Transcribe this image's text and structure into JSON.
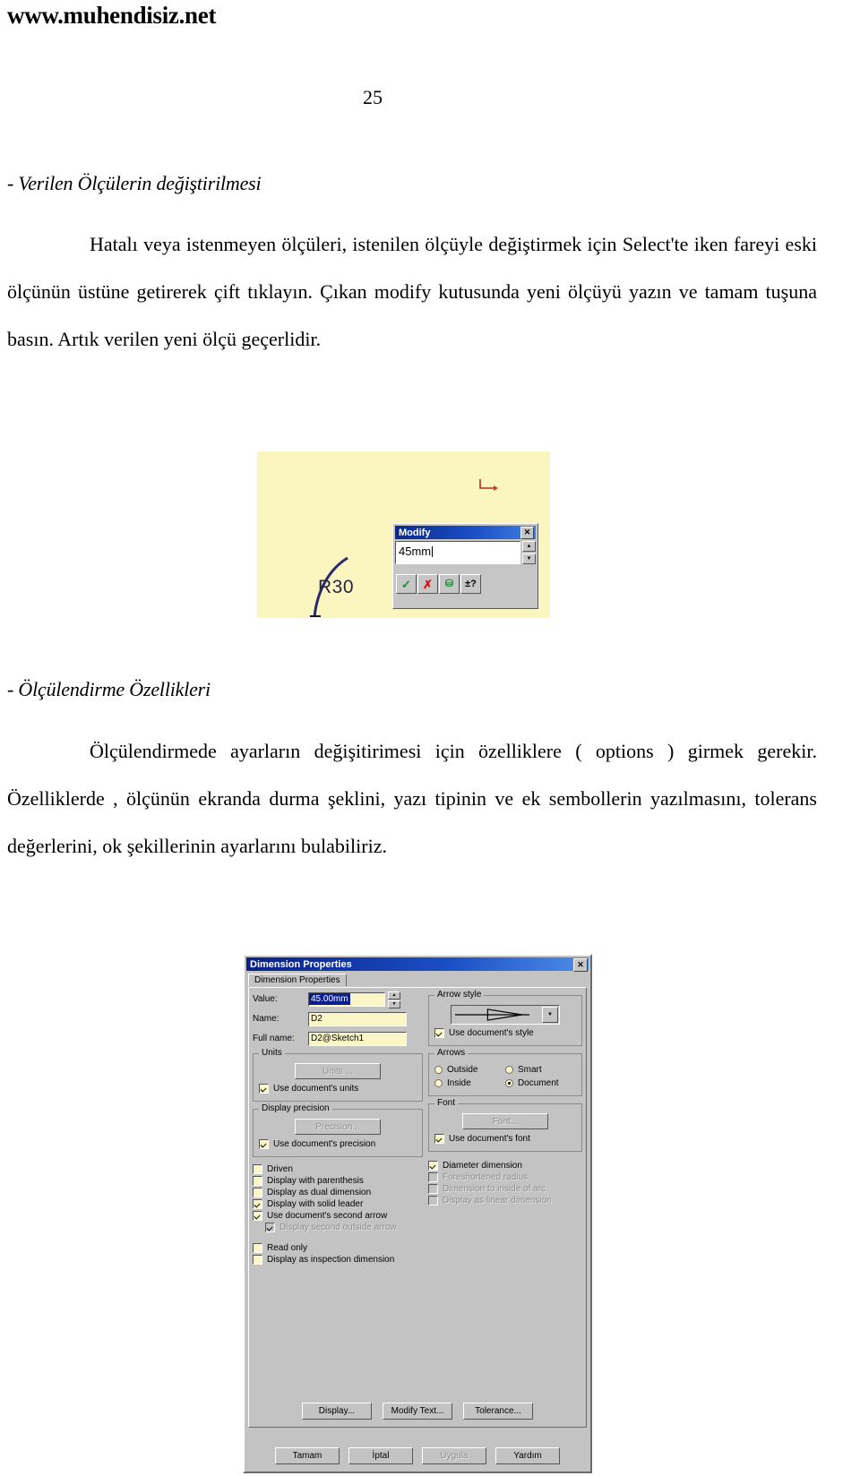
{
  "document": {
    "site_header": "www.muhendisiz.net",
    "page_number": "25",
    "heading_1": "- Verilen Ölçülerin değiştirilmesi",
    "paragraph_1": "Hatalı veya istenmeyen ölçüleri, istenilen ölçüyle değiştirmek için Select'te iken fareyi eski ölçünün üstüne getirerek çift tıklayın. Çıkan modify kutusunda yeni ölçüyü yazın ve tamam tuşuna basın. Artık verilen yeni ölçü geçerlidir.",
    "heading_2": "- Ölçülendirme Özellikleri",
    "paragraph_2": "Ölçülendirmede ayarların değişitirimesi için özelliklere ( options ) girmek gerekir.  Özelliklerde , ölçünün ekranda durma şeklini, yazı tipinin ve ek sembollerin yazılmasını, tolerans değerlerini, ok şekillerinin ayarlarını bulabiliriz."
  },
  "figure_modify": {
    "canvas_color": "#fbf5c0",
    "sketch_label": "R30",
    "dialog": {
      "title": "Modify",
      "close_label": "✕",
      "value": "45mm",
      "spin_up": "▲",
      "spin_down": "▼",
      "buttons": [
        {
          "name": "accept",
          "glyph": "✓"
        },
        {
          "name": "cancel",
          "glyph": "✗"
        },
        {
          "name": "rebuild",
          "glyph": "⛁"
        },
        {
          "name": "tolerance",
          "glyph": "±?"
        }
      ]
    }
  },
  "figure_dimension_properties": {
    "title": "Dimension Properties",
    "close_label": "✕",
    "tab_label": "Dimension Properties",
    "fields": {
      "value_label": "Value:",
      "value": "45.00mm",
      "name_label": "Name:",
      "name": "D2",
      "fullname_label": "Full name:",
      "fullname": "D2@Sketch1"
    },
    "units_group": {
      "legend": "Units",
      "button": "Units ...",
      "checkbox": "Use document's units",
      "checked": true
    },
    "precision_group": {
      "legend": "Display precision",
      "button": "Precision...",
      "checkbox": "Use document's precision",
      "checked": true
    },
    "left_checkboxes": [
      {
        "label": "Driven",
        "checked": false,
        "disabled": false,
        "indent": false
      },
      {
        "label": "Display with parenthesis",
        "checked": false,
        "disabled": false,
        "indent": false
      },
      {
        "label": "Display as dual dimension",
        "checked": false,
        "disabled": false,
        "indent": false
      },
      {
        "label": "Display with solid leader",
        "checked": true,
        "disabled": false,
        "indent": false
      },
      {
        "label": "Use document's second arrow",
        "checked": true,
        "disabled": false,
        "indent": false
      },
      {
        "label": "Display second outside arrow",
        "checked": true,
        "disabled": true,
        "indent": true
      }
    ],
    "left_checkboxes_2": [
      {
        "label": "Read only",
        "checked": false,
        "disabled": false
      },
      {
        "label": "Display as inspection dimension",
        "checked": false,
        "disabled": false
      }
    ],
    "arrow_style_group": {
      "legend": "Arrow style",
      "dropdown_glyph": "▼",
      "checkbox": "Use document's style",
      "checked": true
    },
    "arrows_group": {
      "legend": "Arrows",
      "options": [
        {
          "label": "Outside",
          "selected": false
        },
        {
          "label": "Smart",
          "selected": false
        },
        {
          "label": "Inside",
          "selected": false
        },
        {
          "label": "Document",
          "selected": true
        }
      ]
    },
    "font_group": {
      "legend": "Font",
      "button": "Font...",
      "checkbox": "Use document's font",
      "checked": true
    },
    "right_checkboxes": [
      {
        "label": "Diameter dimension",
        "checked": true,
        "disabled": false
      },
      {
        "label": "Foreshortened radius",
        "checked": false,
        "disabled": true
      },
      {
        "label": "Dimension to inside of arc",
        "checked": false,
        "disabled": true
      },
      {
        "label": "Display as linear dimension",
        "checked": false,
        "disabled": true
      }
    ],
    "action_buttons": [
      {
        "label": "Display...",
        "disabled": false
      },
      {
        "label": "Modify Text...",
        "disabled": false
      },
      {
        "label": "Tolerance...",
        "disabled": false
      }
    ],
    "footer_buttons": [
      {
        "label": "Tamam",
        "disabled": false
      },
      {
        "label": "İptal",
        "disabled": false
      },
      {
        "label": "Uygula",
        "disabled": true
      },
      {
        "label": "Yardım",
        "disabled": false
      }
    ]
  }
}
